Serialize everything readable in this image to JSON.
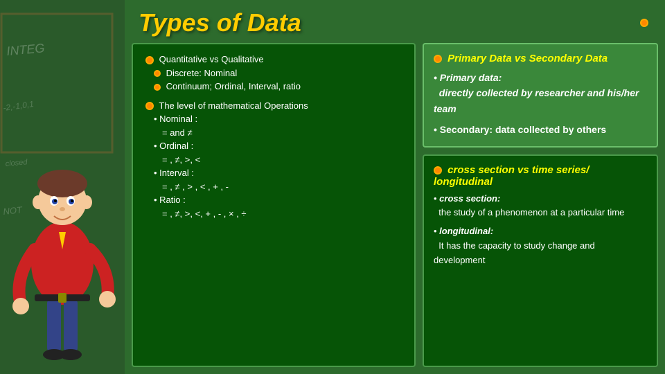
{
  "title": "Types of Data",
  "left_panel": {
    "items": [
      {
        "label": "Quantitative vs Qualitative",
        "subitems": [
          "Discrete: Nominal",
          "Continuum; Ordinal, Interval, ratio"
        ]
      },
      {
        "label": "The level of mathematical Operations",
        "subitems": [
          "• Nominal :",
          "= and ≠",
          "• Ordinal :",
          "= , ≠, >, <",
          "• Interval :",
          "= , ≠ ,  > ,  < , + , -",
          "• Ratio :",
          "= , ≠, >, <, + , - ,  × , ÷"
        ]
      }
    ]
  },
  "top_right": {
    "title": "Primary Data vs Secondary Data",
    "primary_label": "Primary data:",
    "primary_desc": "directly collected by researcher and his/her team",
    "secondary_label": "Secondary:",
    "secondary_desc": "data collected by others"
  },
  "bottom_right": {
    "title": "cross section vs time series/ longitudinal",
    "cross_label": "cross section:",
    "cross_desc": "the study of a phenomenon at a particular time",
    "longitudinal_label": "longitudinal:",
    "longitudinal_desc": "It has the capacity to study change and development"
  },
  "chalkboard_texts": [
    "INTEG",
    "closed",
    "NOT",
    "-2,-1"
  ]
}
